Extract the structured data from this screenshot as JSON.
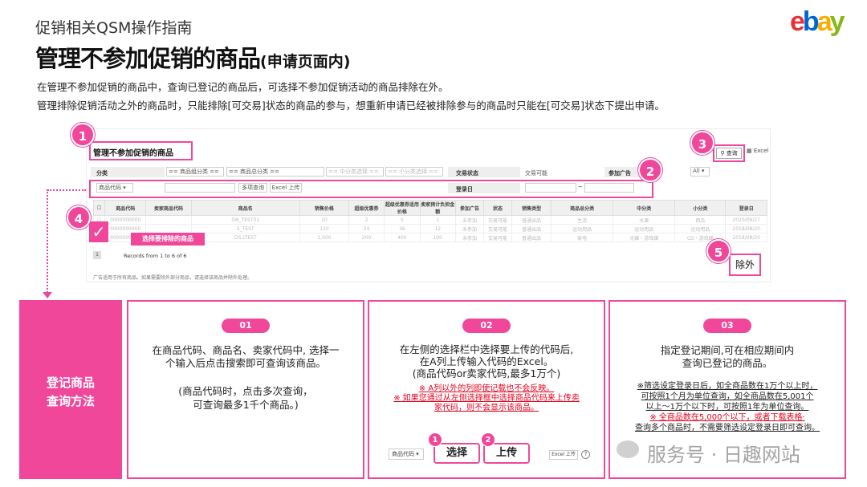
{
  "header": {
    "kicker": "促销相关QSM操作指南",
    "title": "管理不参加促销的商品",
    "title_suffix": "(申请页面内)",
    "desc1": "在管理不参加促销的商品中，查询已登记的商品后，可选择不参加促销活动的商品排除在外。",
    "desc2": "管理排除促销活动之外的商品时，只能排除[可交易]状态的商品的参与，想重新申请已经被排除参与的商品时只能在[可交易]状态下提出申请。",
    "logo_letters": [
      "e",
      "b",
      "a",
      "y"
    ]
  },
  "screenshot": {
    "panel_title": "管理不参加促销的商品",
    "search_label": "查询",
    "excel_label": "Excel",
    "filter": {
      "category_label": "分类",
      "cat1": "== 商品组分类 ==",
      "cat2": "== 商品总分类 ==",
      "cat3": "== 中分类选择 ==",
      "cat4": "== 小分类选择 ==",
      "status_label": "交易状态",
      "status_value": "交易可能",
      "ad_label": "参加广告",
      "ad_value": "All",
      "code_select": "商品代码",
      "multi_btn": "多项查询",
      "excel_upload": "Excel 上传",
      "reg_label": "登录日",
      "date_sep": "~"
    },
    "columns": [
      "商品代码",
      "卖家商品代码",
      "商品名",
      "销售价格",
      "超级优惠券",
      "超级优惠券适用价格",
      "卖家预计负担金额",
      "参加广告",
      "状态",
      "销售类型",
      "商品总分类",
      "中分类",
      "小分类",
      "登录日"
    ],
    "rows": [
      [
        "0000000000",
        "",
        "ON_TEST01",
        "10",
        "2",
        "5",
        "1",
        "未参加",
        "交易可能",
        "普通出品",
        "生活",
        "水果",
        "西瓜",
        "2020/09/27"
      ],
      [
        "0000000000",
        "",
        "5_TEST",
        "120",
        "24",
        "36",
        "12",
        "未参加",
        "交易可能",
        "普通出品",
        "运动用品",
        "运动用品",
        "运动用品",
        "2018/08/20"
      ],
      [
        "0000000000",
        "",
        "DS.LTEST",
        "1,000",
        "200",
        "400",
        "100",
        "未参加",
        "交易可能",
        "普通出品",
        "家电",
        "光碟・游戏碟",
        "CD・游戏碟",
        "2018/08/20"
      ]
    ],
    "select_hint": "选择要排除的商品",
    "records": "Records from 1 to 6 of 6",
    "page_num": "1",
    "exclude_btn": "除外",
    "footnote": "广告适用于所有商品。如果需要除外部分商品，请选择该商品并除外处理。"
  },
  "steps": [
    "1",
    "2",
    "3",
    "4",
    "5"
  ],
  "bottom": {
    "side_title_1": "登记商品",
    "side_title_2": "查询方法",
    "cards": [
      {
        "num": "01",
        "line1": "在商品代码、商品名、卖家代码中, 选择一",
        "line2": "个输入后点击搜索即可查询该商品。",
        "line3": "(商品代码时，点击多次查询，",
        "line4": "可查询最多1千个商品。)"
      },
      {
        "num": "02",
        "line1": "在左侧的选择栏中选择要上传的代码后,",
        "line2": "在A列上传输入代码的Excel。",
        "line3": "(商品代码or卖家代码,最多1万个)",
        "red1": "※ A列以外的列即使记载也不会反映。",
        "red2": "※ 如果您通过从左侧选择框中选择商品代码来上传卖",
        "red3": "家代码，则不会显示该商品。",
        "mini_select": "商品代码",
        "mini_step1": "1",
        "mini_step2": "2",
        "mini_choose": "选择",
        "mini_upload": "上传",
        "mini_excel": "Excel 上传"
      },
      {
        "num": "03",
        "line1": "指定登记期间,可在相应期间内",
        "line2": "查询已登记的商品。",
        "n1": "※筛选设定登录日后，如全商品数在1万个以上时，",
        "n2": "可按照1个月为单位查询，如全商品数在5,001个",
        "n3": "以上～1万个以下时，可按照1年为单位查询。",
        "n4": "※ 全商品数在5,000个以下，或者下载表格·",
        "n5": "查询多个商品时，不需要筛选设定登录日即可查询。"
      }
    ]
  },
  "watermark": "服务号 · 日趣网站",
  "colors": {
    "accent": "#f0479a",
    "side": "#f0479a"
  }
}
